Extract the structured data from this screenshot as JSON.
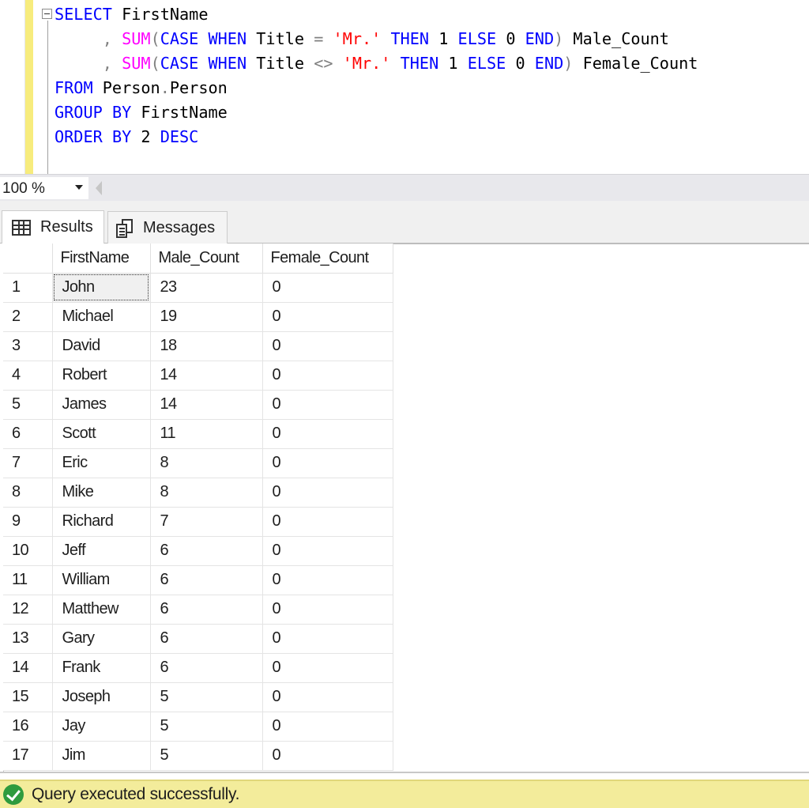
{
  "editor": {
    "lines": [
      [
        {
          "t": "SELECT",
          "c": "kw"
        },
        {
          "t": " FirstName",
          "c": ""
        }
      ],
      [
        {
          "t": "     ",
          "c": ""
        },
        {
          "t": ",",
          "c": "op"
        },
        {
          "t": " ",
          "c": ""
        },
        {
          "t": "SUM",
          "c": "fn"
        },
        {
          "t": "(",
          "c": "op"
        },
        {
          "t": "CASE",
          "c": "kw"
        },
        {
          "t": " ",
          "c": ""
        },
        {
          "t": "WHEN",
          "c": "kw"
        },
        {
          "t": " Title ",
          "c": ""
        },
        {
          "t": "=",
          "c": "op"
        },
        {
          "t": " ",
          "c": ""
        },
        {
          "t": "'Mr.'",
          "c": "str"
        },
        {
          "t": " ",
          "c": ""
        },
        {
          "t": "THEN",
          "c": "kw"
        },
        {
          "t": " 1 ",
          "c": ""
        },
        {
          "t": "ELSE",
          "c": "kw"
        },
        {
          "t": " 0 ",
          "c": ""
        },
        {
          "t": "END",
          "c": "kw"
        },
        {
          "t": ")",
          "c": "op"
        },
        {
          "t": " Male_Count",
          "c": ""
        }
      ],
      [
        {
          "t": "     ",
          "c": ""
        },
        {
          "t": ",",
          "c": "op"
        },
        {
          "t": " ",
          "c": ""
        },
        {
          "t": "SUM",
          "c": "fn"
        },
        {
          "t": "(",
          "c": "op"
        },
        {
          "t": "CASE",
          "c": "kw"
        },
        {
          "t": " ",
          "c": ""
        },
        {
          "t": "WHEN",
          "c": "kw"
        },
        {
          "t": " Title ",
          "c": ""
        },
        {
          "t": "<>",
          "c": "op"
        },
        {
          "t": " ",
          "c": ""
        },
        {
          "t": "'Mr.'",
          "c": "str"
        },
        {
          "t": " ",
          "c": ""
        },
        {
          "t": "THEN",
          "c": "kw"
        },
        {
          "t": " 1 ",
          "c": ""
        },
        {
          "t": "ELSE",
          "c": "kw"
        },
        {
          "t": " 0 ",
          "c": ""
        },
        {
          "t": "END",
          "c": "kw"
        },
        {
          "t": ")",
          "c": "op"
        },
        {
          "t": " Female_Count",
          "c": ""
        }
      ],
      [
        {
          "t": "FROM",
          "c": "kw"
        },
        {
          "t": " Person",
          "c": ""
        },
        {
          "t": ".",
          "c": "op"
        },
        {
          "t": "Person",
          "c": ""
        }
      ],
      [
        {
          "t": "GROUP",
          "c": "kw"
        },
        {
          "t": " ",
          "c": ""
        },
        {
          "t": "BY",
          "c": "kw"
        },
        {
          "t": " FirstName",
          "c": ""
        }
      ],
      [
        {
          "t": "ORDER",
          "c": "kw"
        },
        {
          "t": " ",
          "c": ""
        },
        {
          "t": "BY",
          "c": "kw"
        },
        {
          "t": " 2 ",
          "c": ""
        },
        {
          "t": "DESC",
          "c": "kw"
        }
      ]
    ]
  },
  "zoom": {
    "value": "100 %"
  },
  "tabs": {
    "results": "Results",
    "messages": "Messages"
  },
  "grid": {
    "columns": [
      "",
      "FirstName",
      "Male_Count",
      "Female_Count"
    ],
    "rows": [
      [
        "1",
        "John",
        "23",
        "0"
      ],
      [
        "2",
        "Michael",
        "19",
        "0"
      ],
      [
        "3",
        "David",
        "18",
        "0"
      ],
      [
        "4",
        "Robert",
        "14",
        "0"
      ],
      [
        "5",
        "James",
        "14",
        "0"
      ],
      [
        "6",
        "Scott",
        "11",
        "0"
      ],
      [
        "7",
        "Eric",
        "8",
        "0"
      ],
      [
        "8",
        "Mike",
        "8",
        "0"
      ],
      [
        "9",
        "Richard",
        "7",
        "0"
      ],
      [
        "10",
        "Jeff",
        "6",
        "0"
      ],
      [
        "11",
        "William",
        "6",
        "0"
      ],
      [
        "12",
        "Matthew",
        "6",
        "0"
      ],
      [
        "13",
        "Gary",
        "6",
        "0"
      ],
      [
        "14",
        "Frank",
        "6",
        "0"
      ],
      [
        "15",
        "Joseph",
        "5",
        "0"
      ],
      [
        "16",
        "Jay",
        "5",
        "0"
      ],
      [
        "17",
        "Jim",
        "5",
        "0"
      ]
    ]
  },
  "status": {
    "icon": "success-check-icon",
    "text": "Query executed successfully.",
    "color": "#f3ec9b"
  }
}
